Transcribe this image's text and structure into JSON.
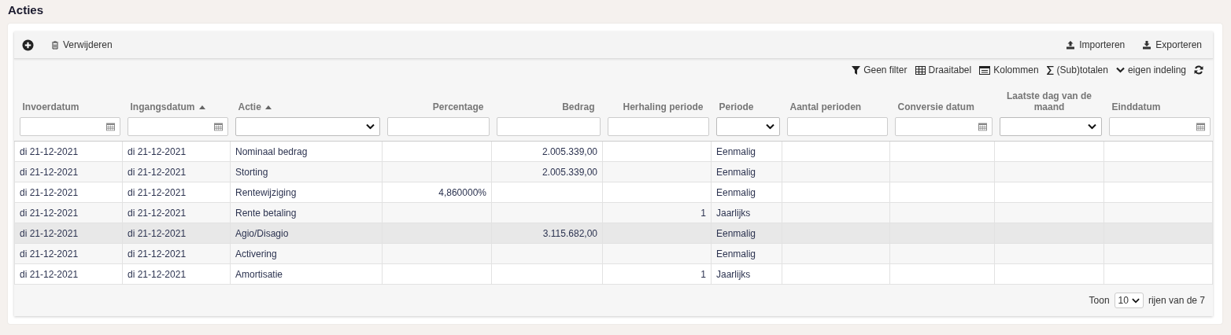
{
  "title": "Acties",
  "toolbar": {
    "delete": "Verwijderen",
    "import": "Importeren",
    "export": "Exporteren"
  },
  "grid_tools": [
    {
      "kind": "filter",
      "label": "Geen filter"
    },
    {
      "kind": "pivot",
      "label": "Draaitabel"
    },
    {
      "kind": "columns",
      "label": "Kolommen"
    },
    {
      "kind": "totals",
      "label": "(Sub)totalen"
    },
    {
      "kind": "layout",
      "label": "eigen indeling"
    },
    {
      "kind": "refresh"
    }
  ],
  "columns": [
    {
      "label": "Invoerdatum",
      "sorted": false,
      "kind": "date"
    },
    {
      "label": "Ingangsdatum",
      "sorted": true,
      "kind": "date"
    },
    {
      "label": "Actie",
      "sorted": true,
      "kind": "select"
    },
    {
      "label": "Percentage",
      "sorted": false,
      "kind": "text"
    },
    {
      "label": "Bedrag",
      "sorted": false,
      "kind": "text"
    },
    {
      "label": "Herhaling periode",
      "sorted": false,
      "kind": "text"
    },
    {
      "label": "Periode",
      "sorted": false,
      "kind": "select"
    },
    {
      "label": "Aantal perioden",
      "sorted": false,
      "kind": "text"
    },
    {
      "label": "Conversie datum",
      "sorted": false,
      "kind": "date"
    },
    {
      "label": "Laatste dag van de maand",
      "sorted": false,
      "kind": "select"
    },
    {
      "label": "Einddatum",
      "sorted": false,
      "kind": "date"
    }
  ],
  "rows": [
    {
      "selected": false,
      "cells": [
        "di 21-12-2021",
        "di 21-12-2021",
        "Nominaal bedrag",
        "",
        "2.005.339,00",
        "",
        "Eenmalig",
        "",
        "",
        "",
        ""
      ]
    },
    {
      "selected": false,
      "cells": [
        "di 21-12-2021",
        "di 21-12-2021",
        "Storting",
        "",
        "2.005.339,00",
        "",
        "Eenmalig",
        "",
        "",
        "",
        ""
      ]
    },
    {
      "selected": false,
      "cells": [
        "di 21-12-2021",
        "di 21-12-2021",
        "Rentewijziging",
        "4,860000%",
        "",
        "",
        "Eenmalig",
        "",
        "",
        "",
        ""
      ]
    },
    {
      "selected": false,
      "cells": [
        "di 21-12-2021",
        "di 21-12-2021",
        "Rente betaling",
        "",
        "",
        "1",
        "Jaarlijks",
        "",
        "",
        "",
        ""
      ]
    },
    {
      "selected": true,
      "cells": [
        "di 21-12-2021",
        "di 21-12-2021",
        "Agio/Disagio",
        "",
        "3.115.682,00",
        "",
        "Eenmalig",
        "",
        "",
        "",
        ""
      ]
    },
    {
      "selected": false,
      "cells": [
        "di 21-12-2021",
        "di 21-12-2021",
        "Activering",
        "",
        "",
        "",
        "Eenmalig",
        "",
        "",
        "",
        ""
      ]
    },
    {
      "selected": false,
      "cells": [
        "di 21-12-2021",
        "di 21-12-2021",
        "Amortisatie",
        "",
        "",
        "1",
        "Jaarlijks",
        "",
        "",
        "",
        ""
      ]
    }
  ],
  "pager": {
    "show": "Toon",
    "page_size": "10",
    "rows_of": "rijen van de 7"
  }
}
